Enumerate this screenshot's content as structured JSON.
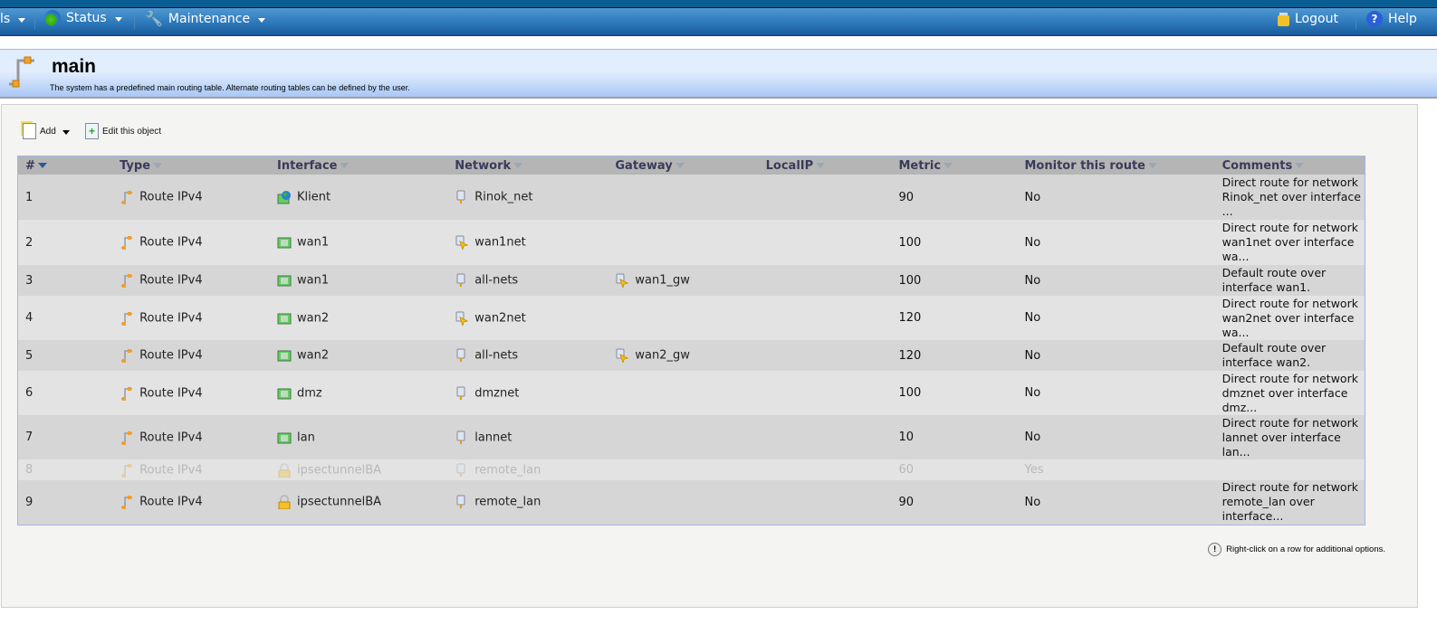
{
  "topnav": {
    "left_partial": "ls",
    "status": "Status",
    "maintenance": "Maintenance",
    "logout": "Logout",
    "help": "Help"
  },
  "header": {
    "title": "main",
    "description": "The system has a predefined main routing table. Alternate routing tables can be defined by the user."
  },
  "toolbar": {
    "add": "Add",
    "edit": "Edit this object"
  },
  "columns": [
    "#",
    "Type",
    "Interface",
    "Network",
    "Gateway",
    "LocalIP",
    "Metric",
    "Monitor this route",
    "Comments"
  ],
  "rows": [
    {
      "num": "1",
      "type": "Route IPv4",
      "iface": "Klient",
      "iface_icon": "globe-interface-icon",
      "network": "Rinok_net",
      "net_icon": "address-icon",
      "gateway": "",
      "localip": "",
      "metric": "90",
      "monitor": "No",
      "comments": "Direct route for network Rinok_net over interface ...",
      "disabled": false
    },
    {
      "num": "2",
      "type": "Route IPv4",
      "iface": "wan1",
      "iface_icon": "ethernet-interface-icon",
      "network": "wan1net",
      "net_icon": "auto-address-icon",
      "gateway": "",
      "localip": "",
      "metric": "100",
      "monitor": "No",
      "comments": "Direct route for network wan1net over interface wa...",
      "disabled": false
    },
    {
      "num": "3",
      "type": "Route IPv4",
      "iface": "wan1",
      "iface_icon": "ethernet-interface-icon",
      "network": "all-nets",
      "net_icon": "address-icon",
      "gateway": "wan1_gw",
      "localip": "",
      "metric": "100",
      "monitor": "No",
      "comments": "Default route over interface wan1.",
      "disabled": false
    },
    {
      "num": "4",
      "type": "Route IPv4",
      "iface": "wan2",
      "iface_icon": "ethernet-interface-icon",
      "network": "wan2net",
      "net_icon": "auto-address-icon",
      "gateway": "",
      "localip": "",
      "metric": "120",
      "monitor": "No",
      "comments": "Direct route for network wan2net over interface wa...",
      "disabled": false
    },
    {
      "num": "5",
      "type": "Route IPv4",
      "iface": "wan2",
      "iface_icon": "ethernet-interface-icon",
      "network": "all-nets",
      "net_icon": "address-icon",
      "gateway": "wan2_gw",
      "localip": "",
      "metric": "120",
      "monitor": "No",
      "comments": "Default route over interface wan2.",
      "disabled": false
    },
    {
      "num": "6",
      "type": "Route IPv4",
      "iface": "dmz",
      "iface_icon": "ethernet-interface-icon",
      "network": "dmznet",
      "net_icon": "address-icon",
      "gateway": "",
      "localip": "",
      "metric": "100",
      "monitor": "No",
      "comments": "Direct route for network dmznet over interface dmz...",
      "disabled": false
    },
    {
      "num": "7",
      "type": "Route IPv4",
      "iface": "lan",
      "iface_icon": "ethernet-interface-icon",
      "network": "lannet",
      "net_icon": "address-icon",
      "gateway": "",
      "localip": "",
      "metric": "10",
      "monitor": "No",
      "comments": "Direct route for network lannet over interface lan...",
      "disabled": false
    },
    {
      "num": "8",
      "type": "Route IPv4",
      "iface": "ipsectunnelBA",
      "iface_icon": "lock-interface-icon",
      "network": "remote_lan",
      "net_icon": "address-icon",
      "gateway": "",
      "localip": "",
      "metric": "60",
      "monitor": "Yes",
      "comments": "",
      "disabled": true
    },
    {
      "num": "9",
      "type": "Route IPv4",
      "iface": "ipsectunnelBA",
      "iface_icon": "lock-interface-icon",
      "network": "remote_lan",
      "net_icon": "address-icon",
      "gateway": "",
      "localip": "",
      "metric": "90",
      "monitor": "No",
      "comments": "Direct route for network remote_lan over interface...",
      "disabled": false
    }
  ],
  "hint": "Right-click on a row for additional options."
}
